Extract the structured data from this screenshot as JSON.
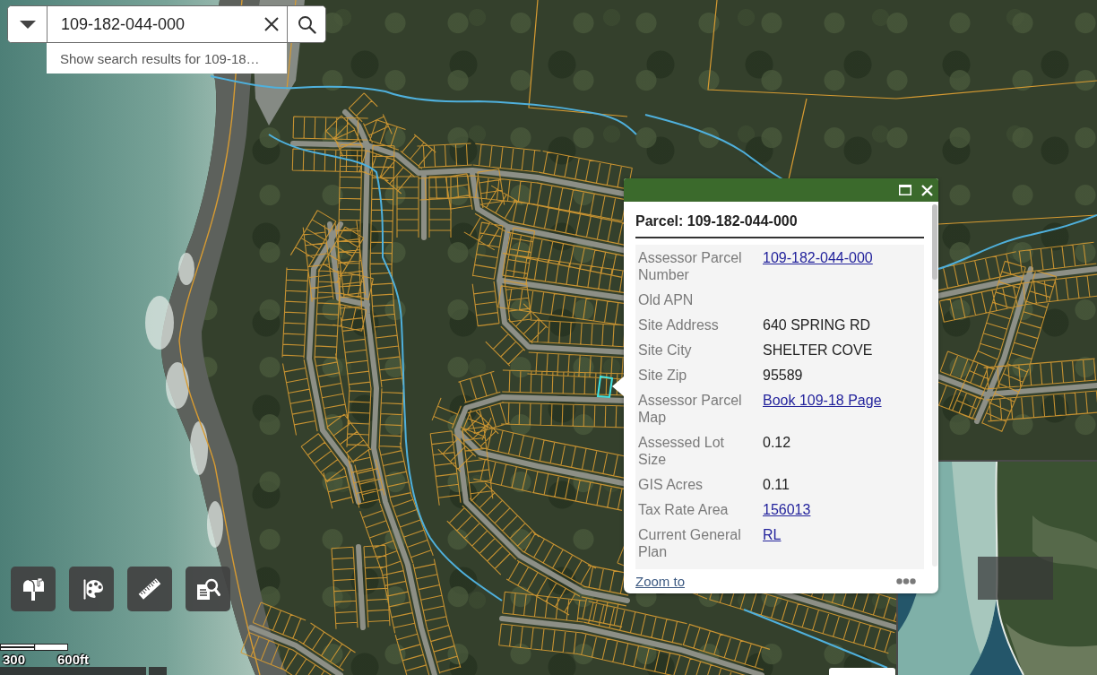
{
  "search": {
    "value": "109-182-044-000",
    "suggestion": "Show search results for 109-18…"
  },
  "popup": {
    "title": "Parcel: 109-182-044-000",
    "fields": [
      {
        "label": "Assessor Parcel Number",
        "value": "109-182-044-000",
        "kind": "link"
      },
      {
        "label": "Old APN"
      },
      {
        "label": "Site Address",
        "value": "640 SPRING RD",
        "kind": "text"
      },
      {
        "label": "Site City",
        "value": "SHELTER COVE",
        "kind": "text"
      },
      {
        "label": "Site Zip",
        "value": "95589",
        "kind": "text"
      },
      {
        "label": "Assessor Parcel Map",
        "value": "Book 109-18 Page",
        "kind": "link"
      },
      {
        "label": "Assessed Lot Size",
        "value": "0.12",
        "kind": "text"
      },
      {
        "label": "GIS Acres",
        "value": "0.11",
        "kind": "text"
      },
      {
        "label": "Tax Rate Area",
        "value": "156013",
        "kind": "link"
      },
      {
        "label": "Current General Plan",
        "value": "RL",
        "kind": "link"
      }
    ],
    "footer_link": "Zoom to"
  },
  "scale_bar": {
    "labels": [
      "300",
      "600ft"
    ]
  }
}
